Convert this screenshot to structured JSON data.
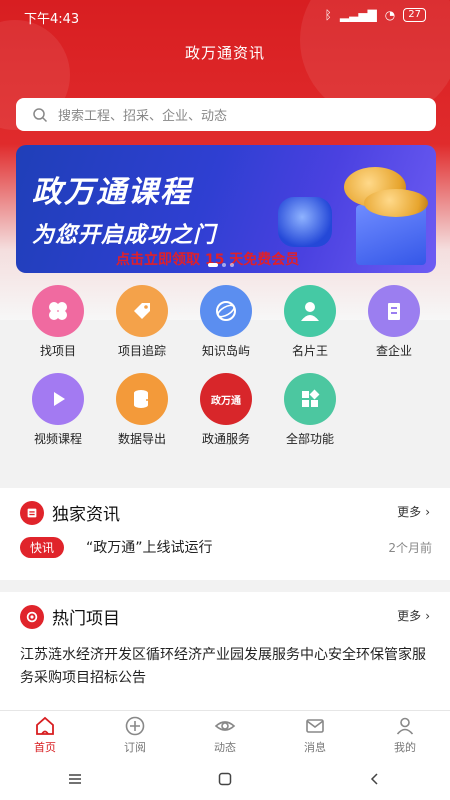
{
  "status_bar": {
    "time": "下午4:43",
    "battery": "27"
  },
  "header": {
    "title": "政万通资讯"
  },
  "search": {
    "placeholder": "搜索工程、招采、企业、动态"
  },
  "banner": {
    "title": "政万通课程",
    "subtitle": "为您开启成功之门",
    "promo": "点击立即领取 15 天免费会员"
  },
  "grid": {
    "row1": [
      {
        "label": "找项目",
        "color": "#f06aa0"
      },
      {
        "label": "项目追踪",
        "color": "#f4a24a"
      },
      {
        "label": "知识岛屿",
        "color": "#5b8ef0"
      },
      {
        "label": "名片王",
        "color": "#45c9a4"
      },
      {
        "label": "查企业",
        "color": "#9b7ef0"
      }
    ],
    "row2": [
      {
        "label": "视频课程",
        "color": "#a37af2"
      },
      {
        "label": "数据导出",
        "color": "#f39a3a"
      },
      {
        "label": "政通服务",
        "color": "#d8262a",
        "icon_text": "政万通"
      },
      {
        "label": "全部功能",
        "color": "#4cc7a0"
      }
    ]
  },
  "news": {
    "title": "独家资讯",
    "more": "更多",
    "badge": "快讯",
    "item": "“政万通”上线试运行",
    "time": "2个月前"
  },
  "hot": {
    "title": "热门项目",
    "more": "更多",
    "item": "江苏涟水经济开发区循环经济产业园发展服务中心安全环保管家服务采购项目招标公告"
  },
  "tabs": [
    {
      "label": "首页",
      "icon": "home-icon"
    },
    {
      "label": "订阅",
      "icon": "plus-circle-icon"
    },
    {
      "label": "动态",
      "icon": "eye-icon"
    },
    {
      "label": "消息",
      "icon": "mail-icon"
    },
    {
      "label": "我的",
      "icon": "user-icon"
    }
  ],
  "colors": {
    "brand_red": "#d81e21"
  }
}
